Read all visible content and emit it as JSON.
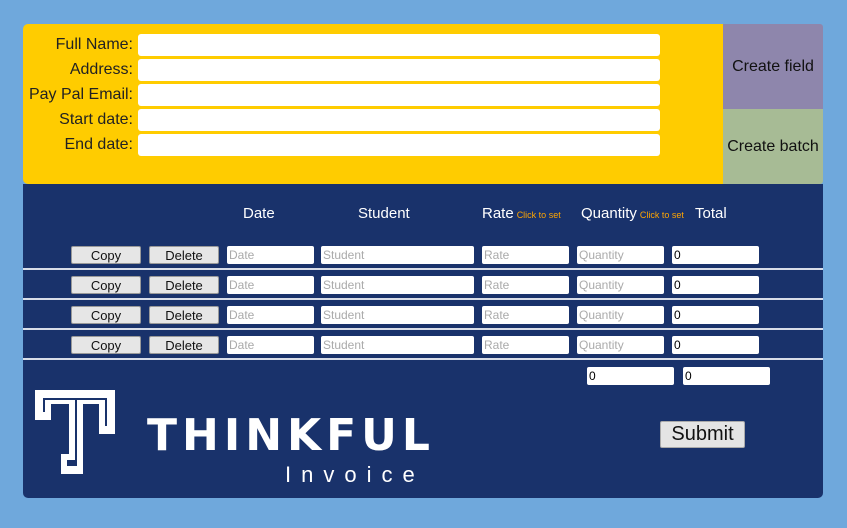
{
  "form": {
    "fields": [
      {
        "label": "Full Name:",
        "value": ""
      },
      {
        "label": "Address:",
        "value": ""
      },
      {
        "label": "Pay Pal Email:",
        "value": ""
      },
      {
        "label": "Start date:",
        "value": ""
      },
      {
        "label": "End date:",
        "value": ""
      }
    ],
    "create_field_label": "Create field",
    "create_batch_label": "Create batch"
  },
  "table": {
    "headers": {
      "date": "Date",
      "student": "Student",
      "rate": "Rate",
      "rate_hint": "Click to set",
      "quantity": "Quantity",
      "quantity_hint": "Click to set",
      "total": "Total"
    },
    "copy_label": "Copy",
    "delete_label": "Delete",
    "placeholders": {
      "date": "Date",
      "student": "Student",
      "rate": "Rate",
      "quantity": "Quantity"
    },
    "rows": [
      {
        "total": "0"
      },
      {
        "total": "0"
      },
      {
        "total": "0"
      },
      {
        "total": "0"
      }
    ],
    "sum_quantity": "0",
    "sum_total": "0"
  },
  "brand": {
    "name": "THINKFUL",
    "subtitle": "Invoice"
  },
  "submit_label": "Submit",
  "colors": {
    "background": "#6fa8dc",
    "form_panel": "#ffcc00",
    "table_panel": "#19326b",
    "hint": "#ffa500"
  }
}
